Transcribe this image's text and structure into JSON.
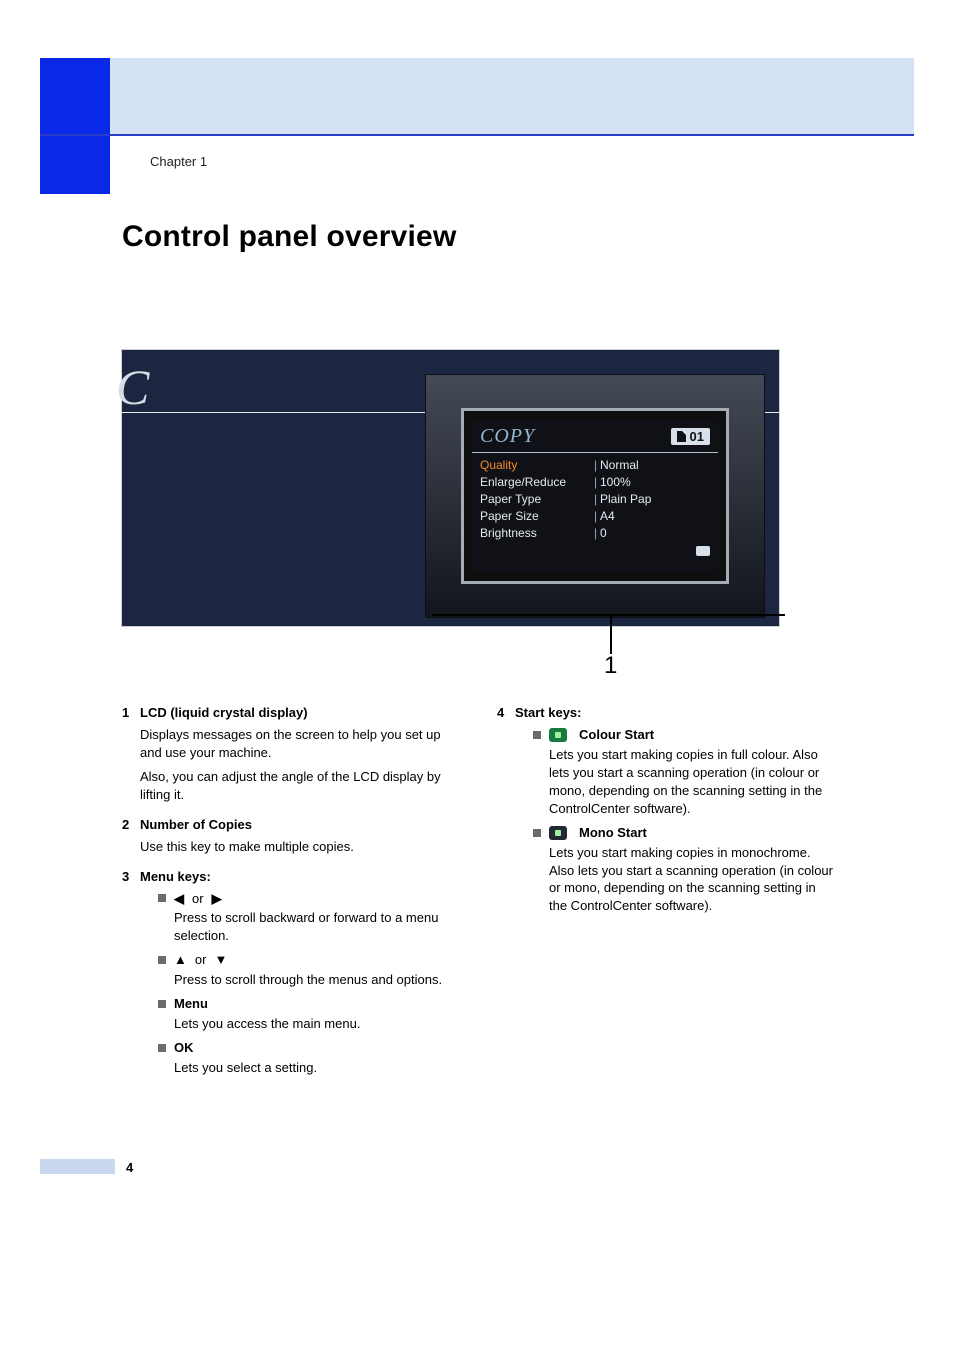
{
  "chapter_label": "Chapter 1",
  "page_title": "Control panel overview",
  "page_number": "4",
  "callout_number": "1",
  "lcd": {
    "title": "COPY",
    "count": "01",
    "rows": [
      {
        "label": "Quality",
        "value": "Normal",
        "selected": true
      },
      {
        "label": "Enlarge/Reduce",
        "value": "100%",
        "selected": false
      },
      {
        "label": "Paper Type",
        "value": "Plain Pap",
        "selected": false
      },
      {
        "label": "Paper Size",
        "value": "A4",
        "selected": false
      },
      {
        "label": "Brightness",
        "value": "0",
        "selected": false
      }
    ]
  },
  "left_col": {
    "item1": {
      "num": "1",
      "title": "LCD (liquid crystal display)",
      "p1": "Displays messages on the screen to help you set up and use your machine.",
      "p2": "Also, you can adjust the angle of the LCD display by lifting it."
    },
    "item2": {
      "num": "2",
      "title": "Number of Copies",
      "p1": "Use this key to make multiple copies."
    },
    "item3": {
      "num": "3",
      "title": "Menu keys:",
      "sub_lr": {
        "label_left": "◀",
        "label_or": "or",
        "label_right": "▶",
        "desc": "Press to scroll backward or forward to a menu selection."
      },
      "sub_ud": {
        "label_up": "▲",
        "label_or": "or",
        "label_down": "▼",
        "desc": "Press to scroll through the menus and options."
      },
      "sub_menu": {
        "label": "Menu",
        "desc": "Lets you access the main menu."
      },
      "sub_ok": {
        "label": "OK",
        "desc": "Lets you select a setting."
      }
    }
  },
  "right_col": {
    "item4": {
      "num": "4",
      "title": "Start keys:",
      "colour": {
        "label": "Colour Start",
        "desc": "Lets you start making copies in full colour. Also lets you start a scanning operation (in colour or mono, depending on the scanning setting in the ControlCenter software)."
      },
      "mono": {
        "label": "Mono Start",
        "desc": "Lets you start making copies in monochrome. Also lets you start a scanning operation (in colour or mono, depending on the scanning setting in the ControlCenter software)."
      }
    }
  }
}
